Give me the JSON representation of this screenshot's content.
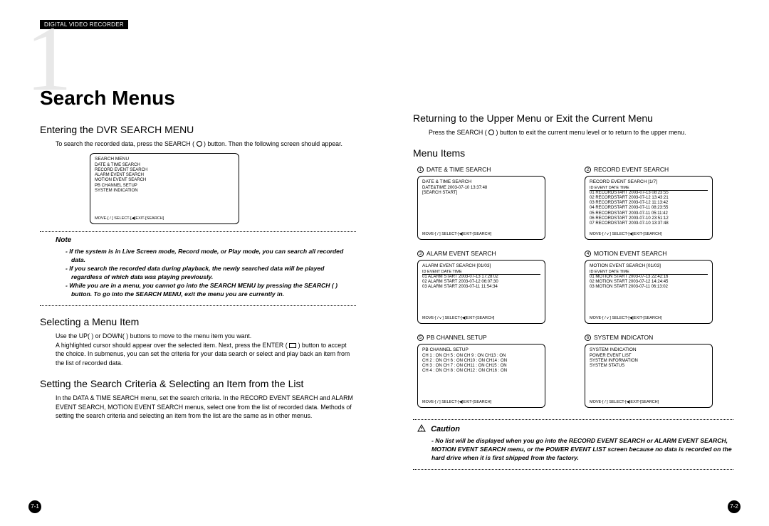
{
  "header_tag": "DIGITAL VIDEO RECORDER",
  "big_numeral": "1",
  "chapter_title": "Search Menus",
  "page_left_num": "7-1",
  "page_right_num": "7-2",
  "left": {
    "s1_h": "Entering the DVR SEARCH MENU",
    "s1_body_a": "To search the recorded data, press the SEARCH (",
    "s1_body_b": ") button. Then the following screen should appear.",
    "screen1": {
      "title": "SEARCH MENU",
      "lines": [
        "DATE & TIME SEARCH",
        "RECORD EVENT SEARCH",
        "ALARM EVENT SEARCH",
        "MOTION EVENT SEARCH",
        "PB CHANNEL SETUP",
        "SYSTEM INDICATION"
      ],
      "foot": "MOVE-[  /  ]  SELECT-[◀]EXIT-[SEARCH]"
    },
    "note_h": "Note",
    "note_items": [
      "- If the system is in Live Screen mode, Record mode, or Play mode, you can search all recorded data.",
      "- If you search the recorded data during playback, the newly searched data will be played regardless of which data was playing previously.",
      "- While you are in a menu, you cannot go into the SEARCH MENU by pressing the SEARCH (   ) button. To go into the SEARCH MENU, exit the menu you are currently in."
    ],
    "s2_h": "Selecting a Menu Item",
    "s2_body_a": "Use the UP(   ) or DOWN(   ) buttons to move to the menu item you want.",
    "s2_body_b": "A highlighted cursor should appear over the selected item. Next, press the ENTER (",
    "s2_body_c": ") button to accept the choice. In submenus, you can set the criteria for your data search or select and play back an item from the list of recorded data.",
    "s3_h": "Setting the Search Criteria & Selecting an Item from the List",
    "s3_body": "In the DATA & TIME SEARCH menu, set the search criteria. In the RECORD EVENT SEARCH and ALARM EVENT SEARCH, MOTION EVENT SEARCH menus, select one from the list of recorded data. Methods of setting the search criteria and selecting an item from the list are the same as in other menus."
  },
  "right": {
    "s1_h": "Returning to the Upper Menu or Exit the Current Menu",
    "s1_body_a": "Press the SEARCH (",
    "s1_body_b": ") button to exit the current menu level or to return to the upper menu.",
    "s2_h": "Menu Items",
    "labels": {
      "l1": "DATE & TIME SEARCH",
      "l2": "RECORD EVENT SEARCH",
      "l3": "ALARM EVENT SEARCH",
      "l4": "MOTION EVENT SEARCH",
      "l5": "PB CHANNEL SETUP",
      "l6": "SYSTEM INDICATON"
    },
    "screens": {
      "sc1": {
        "title": "DATE & TIME SEARCH",
        "lines": [
          "DATE&TIME  2003-07-10  13:37:48",
          "[SEARCH START]"
        ],
        "foot": "MOVE-[  /  ]  SELECT-[◀]EXIT-[SEARCH]"
      },
      "sc2": {
        "title": "RECORD EVENT SEARCH        [1/7]",
        "thead": "ID    EVENT            DATE            TIME",
        "lines": [
          "01  RECORDSTART 2003-07-13 08:23:55",
          "02  RECORDSTART 2003-07-12 13:43:21",
          "03  RECORDSTART 2003-07-12 11:13:42",
          "04  RECORDSTART 2003-07-11 08:23:55",
          "05  RECORDSTART 2003-07-11 05:11:42",
          "06  RECORDSTART 2003-07-10 23:51:12",
          "07  RECORDSTART 2003-07-10 13:37:48"
        ],
        "foot": "MOVE-[  /  v  ]  SELECT-[◀]EXIT-[SEARCH]"
      },
      "sc3": {
        "title": "ALARM EVENT SEARCH       [01/03]",
        "thead": "ID    EVENT            DATE            TIME",
        "lines": [
          "01 ALARM START 2003-07-13 17:28:02",
          "02 ALARM START 2003-07-12 06:07:30",
          "03 ALARM START 2003-07-11 11:54:34"
        ],
        "foot": "MOVE-[  /  v  ]  SELECT-[◀]EXIT-[SEARCH]"
      },
      "sc4": {
        "title": "MOTION EVENT SEARCH      [01/03]",
        "thead": "ID    EVENT            DATE            TIME",
        "lines": [
          "01  MOTION START 2003-07-13 22:42:16",
          "02  MOTION START 2003-07-12 14:24:45",
          "03  MOTION START 2003-07-11 06:13:02"
        ],
        "foot": "MOVE-[  /  v  ]  SELECT-[◀]EXIT-[SEARCH]"
      },
      "sc5": {
        "title": "PB CHANNEL SETUP",
        "lines": [
          "CH 1 : ON  CH 5 : ON  CH 9 : ON  CH13 : ON",
          "CH 2 : ON  CH 6 : ON  CH10 : ON  CH14 : ON",
          "CH 3 : ON  CH 7 : ON  CH11 : ON  CH15 : ON",
          "CH 4 : ON  CH 8 : ON  CH12 : ON  CH16 : ON"
        ],
        "foot": "MOVE-[  /  ]  SELECT-[◀]EXIT-[SEARCH]"
      },
      "sc6": {
        "title": "SYSTEM INDICATION",
        "lines": [
          "POWER EVENT LIST",
          "SYSTEM INFORMATION",
          "SYSTEM STATUS"
        ],
        "foot": "MOVE-[  /  ]  SELECT-[◀]EXIT-[SEARCH]"
      }
    },
    "caution_h": "Caution",
    "caution_body": "-   No list will be displayed when you go into the RECORD EVENT SEARCH or ALARM EVENT SEARCH, MOTION EVENT SEARCH menu, or the POWER EVENT LIST screen because no data is recorded on the hard drive when it is first shipped from the factory."
  }
}
